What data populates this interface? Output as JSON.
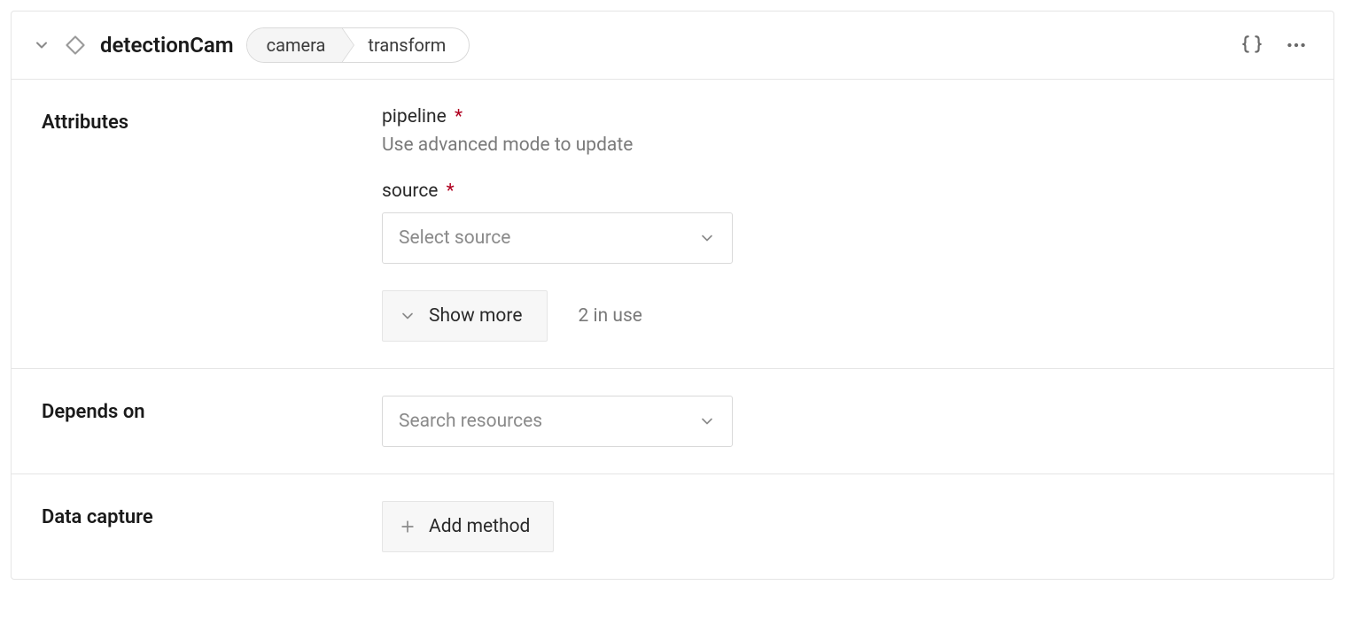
{
  "header": {
    "component_name": "detectionCam",
    "breadcrumb": {
      "type": "camera",
      "model": "transform"
    }
  },
  "sections": {
    "attributes": {
      "label": "Attributes",
      "pipeline": {
        "label": "pipeline",
        "required_marker": "*",
        "hint": "Use advanced mode to update"
      },
      "source": {
        "label": "source",
        "required_marker": "*",
        "placeholder": "Select source"
      },
      "show_more": {
        "label": "Show more",
        "in_use_text": "2 in use"
      }
    },
    "depends_on": {
      "label": "Depends on",
      "placeholder": "Search resources"
    },
    "data_capture": {
      "label": "Data capture",
      "add_label": "Add method"
    }
  }
}
